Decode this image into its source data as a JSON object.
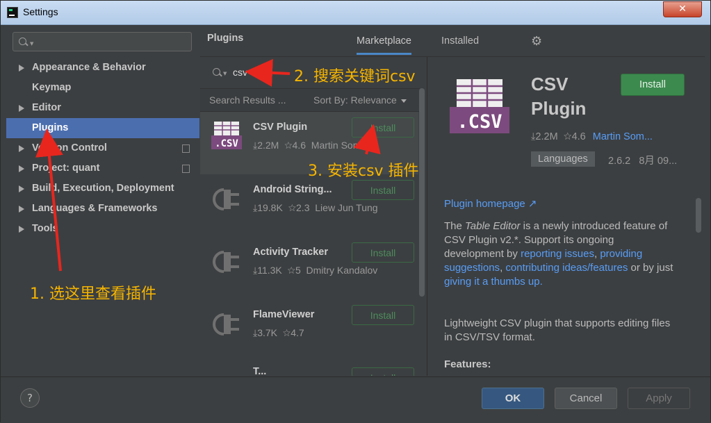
{
  "window": {
    "title": "Settings",
    "close_label": "✕"
  },
  "sidebar": {
    "search_placeholder": "",
    "items": [
      {
        "label": "Appearance & Behavior",
        "expandable": true
      },
      {
        "label": "Keymap",
        "expandable": false
      },
      {
        "label": "Editor",
        "expandable": true
      },
      {
        "label": "Plugins",
        "expandable": false,
        "selected": true
      },
      {
        "label": "Version Control",
        "expandable": true
      },
      {
        "label": "Project: quant",
        "expandable": true
      },
      {
        "label": "Build, Execution, Deployment",
        "expandable": true
      },
      {
        "label": "Languages & Frameworks",
        "expandable": true
      },
      {
        "label": "Tools",
        "expandable": true
      }
    ]
  },
  "plugins": {
    "title": "Plugins",
    "tabs": [
      {
        "label": "Marketplace",
        "active": true
      },
      {
        "label": "Installed",
        "active": false
      }
    ],
    "search_query": "csv",
    "results_label": "Search Results ...",
    "sort_label": "Sort By: Relevance",
    "list": [
      {
        "name": "CSV Plugin",
        "downloads": "2.2M",
        "rating": "4.6",
        "author": "Martin Sommer",
        "install_label": "Install",
        "icon": "csv-file-icon"
      },
      {
        "name": "Android String...",
        "downloads": "19.8K",
        "rating": "2.3",
        "author": "Liew Jun Tung",
        "install_label": "Install",
        "icon": "plugin-plug-icon"
      },
      {
        "name": "Activity Tracker",
        "downloads": "11.3K",
        "rating": "5",
        "author": "Dmitry Kandalov",
        "install_label": "Install",
        "icon": "plugin-plug-icon"
      },
      {
        "name": "FlameViewer",
        "downloads": "3.7K",
        "rating": "4.7",
        "author": "",
        "install_label": "Install",
        "icon": "plugin-plug-icon"
      },
      {
        "name": "T...",
        "downloads": "",
        "rating": "",
        "author": "",
        "install_label": "Install",
        "icon": "plugin-plug-icon"
      }
    ]
  },
  "details": {
    "name_line1": "CSV",
    "name_line2": "Plugin",
    "install_label": "Install",
    "downloads": "2.2M",
    "rating": "4.6",
    "author": "Martin Som...",
    "tag": "Languages",
    "version": "2.6.2",
    "date": "8月 09...",
    "homepage_label": "Plugin homepage ↗",
    "desc_p1_pre": "The ",
    "desc_p1_em": "Table Editor",
    "desc_p1_mid": " is a newly introduced feature of CSV Plugin v2.*. Support its ongoing development by ",
    "link_reporting": "reporting issues",
    "sep1": ", ",
    "link_providing": "providing suggestions",
    "sep2": ", ",
    "link_contrib": "contributing ideas/features",
    "desc_p1_or": " or by just ",
    "link_thumbs": "giving it a thumbs up.",
    "desc_p2": "Lightweight CSV plugin that supports editing files in CSV/TSV format.",
    "features_label": "Features:"
  },
  "footer": {
    "help_label": "?",
    "ok_label": "OK",
    "cancel_label": "Cancel",
    "apply_label": "Apply"
  },
  "annotations": {
    "step1": "1. 选这里查看插件",
    "step2": "2. 搜索关键词csv",
    "step3": "3. 安装csv 插件",
    "color": "#f5b400",
    "arrow_color": "#e8261e"
  },
  "colors": {
    "selection": "#4b6eaf",
    "link": "#589df6",
    "install_green": "#3c8a4e"
  }
}
